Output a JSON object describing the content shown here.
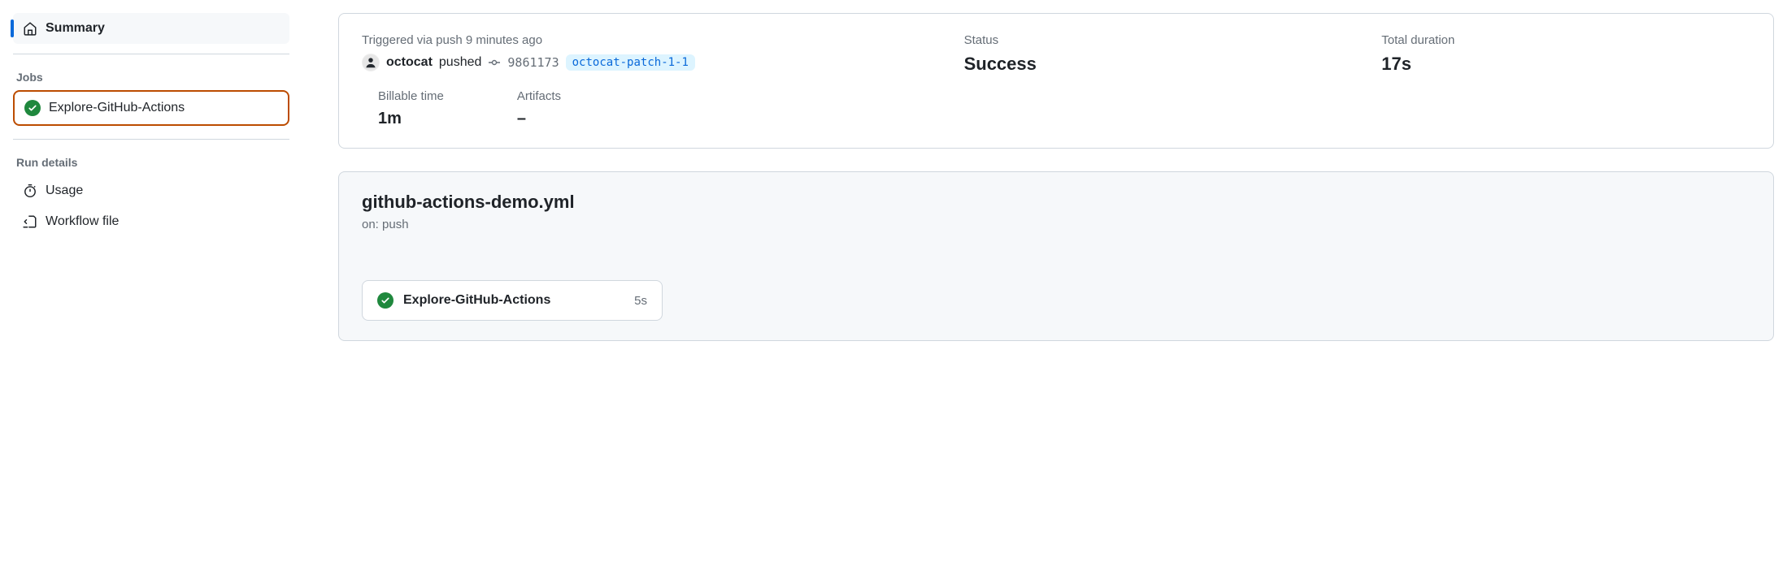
{
  "sidebar": {
    "summary_label": "Summary",
    "jobs_heading": "Jobs",
    "job_name": "Explore-GitHub-Actions",
    "run_details_heading": "Run details",
    "usage_label": "Usage",
    "workflow_file_label": "Workflow file"
  },
  "summary": {
    "trigger_prefix": "Triggered via push",
    "trigger_time": "9 minutes ago",
    "actor": "octocat",
    "action_verb": "pushed",
    "commit_sha": "9861173",
    "branch": "octocat-patch-1-1",
    "status_label": "Status",
    "status_value": "Success",
    "duration_label": "Total duration",
    "duration_value": "17s",
    "billable_label": "Billable time",
    "billable_value": "1m",
    "artifacts_label": "Artifacts",
    "artifacts_value": "–"
  },
  "workflow": {
    "file": "github-actions-demo.yml",
    "trigger": "on: push",
    "job_name": "Explore-GitHub-Actions",
    "job_time": "5s"
  }
}
